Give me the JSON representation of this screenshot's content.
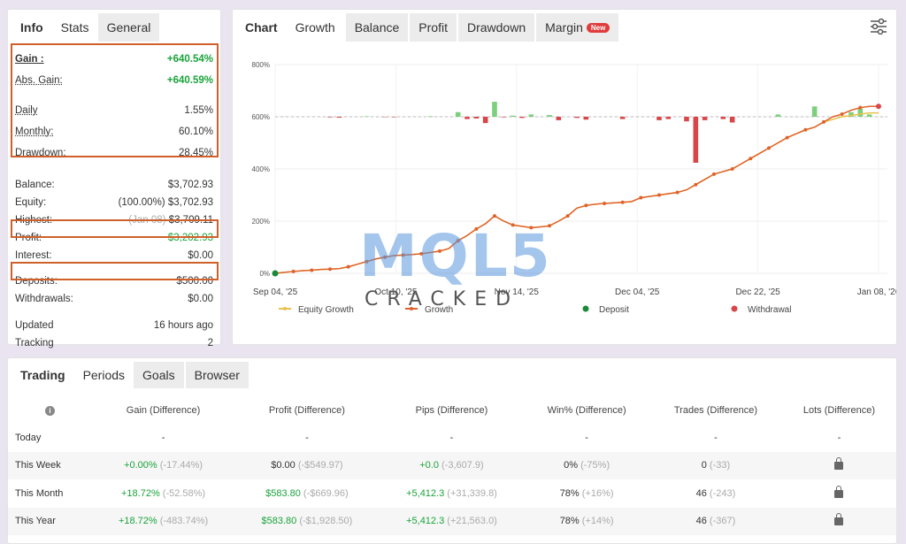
{
  "info_tabs": [
    "Info",
    "Stats",
    "General"
  ],
  "stats": {
    "gain": {
      "label": "Gain :",
      "value": "+640.54%"
    },
    "abs_gain": {
      "label": "Abs. Gain:",
      "value": "+640.59%"
    },
    "daily": {
      "label": "Daily",
      "value": "1.55%"
    },
    "monthly": {
      "label": "Monthly:",
      "value": "60.10%"
    },
    "drawdown": {
      "label": "Drawdown:",
      "value": "28.45%"
    },
    "balance": {
      "label": "Balance:",
      "value": "$3,702.93"
    },
    "equity": {
      "label": "Equity:",
      "prefix": "(100.00%)",
      "value": "$3,702.93"
    },
    "highest": {
      "label": "Highest:",
      "prefix": "(Jan 08)",
      "value": "$3,709.11"
    },
    "profit": {
      "label": "Profit:",
      "value": "$3,202.93"
    },
    "interest": {
      "label": "Interest:",
      "value": "$0.00"
    },
    "deposits": {
      "label": "Deposits:",
      "value": "$500.00"
    },
    "withdrawals": {
      "label": "Withdrawals:",
      "value": "$0.00"
    },
    "updated": {
      "label": "Updated",
      "value": "16 hours ago"
    },
    "tracking": {
      "label": "Tracking",
      "value": "2"
    }
  },
  "chart_tabs": [
    "Chart",
    "Growth",
    "Balance",
    "Profit",
    "Drawdown",
    "Margin"
  ],
  "chart_tab_badge": "New",
  "chart_legend": [
    "Equity Growth",
    "Growth",
    "Deposit",
    "Withdrawal"
  ],
  "watermark": {
    "top": "MQL5",
    "bottom": "CRACKED"
  },
  "chart_data": {
    "type": "line",
    "x_ticks": [
      "Sep 04, '25",
      "Oct 10, '25",
      "Nov 14, '25",
      "Dec 04, '25",
      "Dec 22, '25",
      "Jan 08, '26"
    ],
    "y_ticks": [
      "0%",
      "200%",
      "400%",
      "600%",
      "800%"
    ],
    "ylim": [
      0,
      800
    ],
    "series": [
      {
        "name": "Growth",
        "color": "#e0622a",
        "values": [
          0,
          4,
          7,
          10,
          12,
          15,
          16,
          18,
          25,
          35,
          45,
          55,
          62,
          68,
          70,
          72,
          75,
          80,
          85,
          95,
          125,
          145,
          170,
          190,
          220,
          200,
          185,
          180,
          175,
          178,
          182,
          200,
          220,
          250,
          260,
          265,
          268,
          270,
          272,
          275,
          290,
          295,
          300,
          305,
          310,
          320,
          340,
          360,
          380,
          390,
          400,
          420,
          440,
          460,
          480,
          500,
          520,
          535,
          550,
          560,
          580,
          600,
          610,
          625,
          635,
          640,
          640
        ]
      },
      {
        "name": "Equity Growth",
        "color": "#e8c24a",
        "values": [
          0,
          4,
          7,
          10,
          12,
          15,
          16,
          18,
          25,
          35,
          45,
          55,
          62,
          68,
          70,
          72,
          75,
          80,
          85,
          95,
          125,
          145,
          170,
          190,
          220,
          200,
          185,
          180,
          175,
          178,
          182,
          200,
          220,
          250,
          260,
          265,
          268,
          270,
          272,
          275,
          290,
          295,
          300,
          305,
          310,
          320,
          340,
          360,
          380,
          390,
          400,
          420,
          440,
          460,
          480,
          500,
          520,
          535,
          550,
          560,
          580,
          590,
          600,
          605,
          610,
          615,
          615
        ]
      }
    ],
    "daily_bars": [
      0,
      1,
      0,
      0,
      0,
      0,
      -5,
      -8,
      0,
      0,
      4,
      0,
      -3,
      -4,
      0,
      0,
      0,
      5,
      0,
      0,
      40,
      -20,
      -15,
      -55,
      130,
      -5,
      10,
      -10,
      20,
      0,
      15,
      -30,
      0,
      -10,
      -25,
      0,
      0,
      0,
      -20,
      0,
      0,
      0,
      -30,
      -20,
      0,
      -40,
      -400,
      -30,
      0,
      -20,
      -50,
      0,
      0,
      0,
      0,
      20,
      0,
      0,
      0,
      90,
      0,
      0,
      0,
      40,
      70,
      20,
      0
    ],
    "deposit_marker": {
      "x_index": 0,
      "value": 0
    },
    "withdrawal_marker": {
      "x_index": 66,
      "value": 640
    }
  },
  "periods_tabs": [
    "Trading",
    "Periods",
    "Goals",
    "Browser"
  ],
  "periods_table": {
    "headers": [
      "Gain (Difference)",
      "Profit (Difference)",
      "Pips (Difference)",
      "Win% (Difference)",
      "Trades (Difference)",
      "Lots (Difference)"
    ],
    "rows": [
      {
        "label": "Today",
        "gain": "-",
        "gain_diff": "",
        "profit": "-",
        "profit_diff": "",
        "pips": "-",
        "pips_diff": "",
        "win": "-",
        "win_diff": "",
        "trades": "-",
        "trades_diff": "",
        "lots": "-"
      },
      {
        "label": "This Week",
        "gain": "+0.00%",
        "gain_diff": "(-17.44%)",
        "profit": "$0.00",
        "profit_diff": "(-$549.97)",
        "pips": "+0.0",
        "pips_diff": "(-3,607.9)",
        "win": "0%",
        "win_diff": "(-75%)",
        "trades": "0",
        "trades_diff": "(-33)",
        "lots": "lock"
      },
      {
        "label": "This Month",
        "gain": "+18.72%",
        "gain_diff": "(-52.58%)",
        "profit": "$583.80",
        "profit_diff": "(-$669.96)",
        "pips": "+5,412.3",
        "pips_diff": "(+31,339.8)",
        "win": "78%",
        "win_diff": "(+16%)",
        "trades": "46",
        "trades_diff": "(-243)",
        "lots": "lock"
      },
      {
        "label": "This Year",
        "gain": "+18.72%",
        "gain_diff": "(-483.74%)",
        "profit": "$583.80",
        "profit_diff": "(-$1,928.50)",
        "pips": "+5,412.3",
        "pips_diff": "(+21,563.0)",
        "win": "78%",
        "win_diff": "(+14%)",
        "trades": "46",
        "trades_diff": "(-367)",
        "lots": "lock"
      }
    ]
  }
}
